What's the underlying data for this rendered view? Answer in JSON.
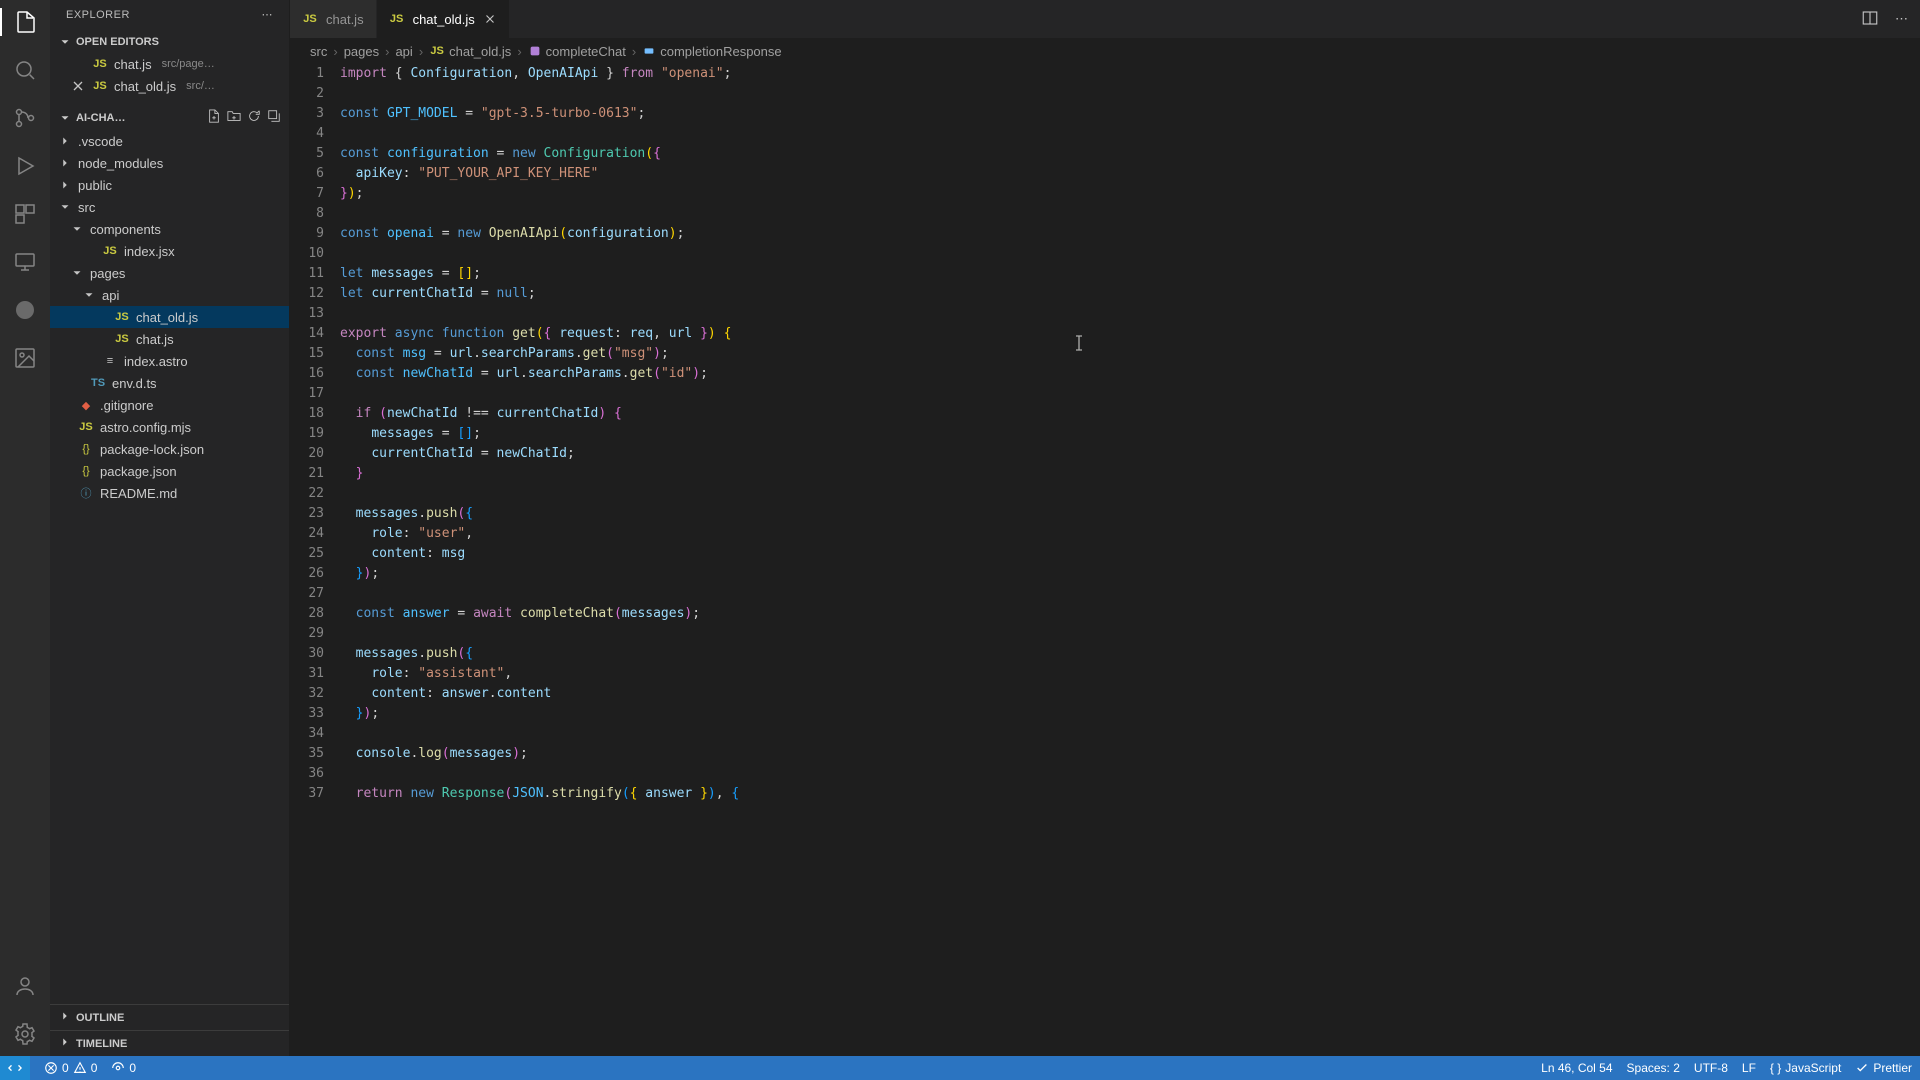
{
  "sidebar": {
    "title": "EXPLORER",
    "openEditors": {
      "title": "OPEN EDITORS",
      "items": [
        {
          "name": "chat.js",
          "path": "src/page…",
          "iconCls": "js",
          "iconText": "JS",
          "dirty": false
        },
        {
          "name": "chat_old.js",
          "path": "src/…",
          "iconCls": "js",
          "iconText": "JS",
          "dirty": false,
          "active": true
        }
      ]
    },
    "project": {
      "title": "AI-CHA…",
      "tree": [
        {
          "name": ".vscode",
          "type": "folder",
          "depth": 0,
          "open": false
        },
        {
          "name": "node_modules",
          "type": "folder",
          "depth": 0,
          "open": false
        },
        {
          "name": "public",
          "type": "folder",
          "depth": 0,
          "open": false
        },
        {
          "name": "src",
          "type": "folder",
          "depth": 0,
          "open": true
        },
        {
          "name": "components",
          "type": "folder",
          "depth": 1,
          "open": true
        },
        {
          "name": "index.jsx",
          "type": "file",
          "depth": 2,
          "iconCls": "js",
          "iconText": "JS"
        },
        {
          "name": "pages",
          "type": "folder",
          "depth": 1,
          "open": true
        },
        {
          "name": "api",
          "type": "folder",
          "depth": 2,
          "open": true
        },
        {
          "name": "chat_old.js",
          "type": "file",
          "depth": 3,
          "iconCls": "js",
          "iconText": "JS",
          "selected": true
        },
        {
          "name": "chat.js",
          "type": "file",
          "depth": 3,
          "iconCls": "js",
          "iconText": "JS"
        },
        {
          "name": "index.astro",
          "type": "file",
          "depth": 2,
          "iconCls": "astro",
          "iconText": "≡"
        },
        {
          "name": "env.d.ts",
          "type": "file",
          "depth": 1,
          "iconCls": "ts",
          "iconText": "TS"
        },
        {
          "name": ".gitignore",
          "type": "file",
          "depth": 0,
          "iconCls": "git",
          "iconText": "◆"
        },
        {
          "name": "astro.config.mjs",
          "type": "file",
          "depth": 0,
          "iconCls": "js",
          "iconText": "JS"
        },
        {
          "name": "package-lock.json",
          "type": "file",
          "depth": 0,
          "iconCls": "json",
          "iconText": "{}"
        },
        {
          "name": "package.json",
          "type": "file",
          "depth": 0,
          "iconCls": "json",
          "iconText": "{}"
        },
        {
          "name": "README.md",
          "type": "file",
          "depth": 0,
          "iconCls": "md",
          "iconText": "ⓘ"
        }
      ]
    },
    "outline": "OUTLINE",
    "timeline": "TIMELINE"
  },
  "tabs": [
    {
      "label": "chat.js",
      "iconCls": "js",
      "iconText": "JS",
      "active": false
    },
    {
      "label": "chat_old.js",
      "iconCls": "js",
      "iconText": "JS",
      "active": true
    }
  ],
  "breadcrumbs": [
    {
      "label": "src"
    },
    {
      "label": "pages"
    },
    {
      "label": "api"
    },
    {
      "label": "chat_old.js",
      "icon": "js"
    },
    {
      "label": "completeChat",
      "icon": "method"
    },
    {
      "label": "completionResponse",
      "icon": "variable"
    }
  ],
  "code": [
    [
      [
        "kw",
        "import"
      ],
      [
        "punc",
        " { "
      ],
      [
        "var",
        "Configuration"
      ],
      [
        "punc",
        ", "
      ],
      [
        "var",
        "OpenAIApi"
      ],
      [
        "punc",
        " } "
      ],
      [
        "kw",
        "from"
      ],
      [
        "punc",
        " "
      ],
      [
        "str",
        "\"openai\""
      ],
      [
        "punc",
        ";"
      ]
    ],
    [],
    [
      [
        "kw2",
        "const"
      ],
      [
        "punc",
        " "
      ],
      [
        "const",
        "GPT_MODEL"
      ],
      [
        "punc",
        " = "
      ],
      [
        "str",
        "\"gpt-3.5-turbo-0613\""
      ],
      [
        "punc",
        ";"
      ]
    ],
    [],
    [
      [
        "kw2",
        "const"
      ],
      [
        "punc",
        " "
      ],
      [
        "const",
        "configuration"
      ],
      [
        "punc",
        " = "
      ],
      [
        "kw2",
        "new"
      ],
      [
        "punc",
        " "
      ],
      [
        "cls",
        "Configuration"
      ],
      [
        "brace",
        "("
      ],
      [
        "brace2",
        "{"
      ]
    ],
    [
      [
        "punc",
        "  "
      ],
      [
        "var",
        "apiKey"
      ],
      [
        "punc",
        ": "
      ],
      [
        "str",
        "\"PUT_YOUR_API_KEY_HERE\""
      ]
    ],
    [
      [
        "brace2",
        "}"
      ],
      [
        "brace",
        ")"
      ],
      [
        "punc",
        ";"
      ]
    ],
    [],
    [
      [
        "kw2",
        "const"
      ],
      [
        "punc",
        " "
      ],
      [
        "const",
        "openai"
      ],
      [
        "punc",
        " = "
      ],
      [
        "kw2",
        "new"
      ],
      [
        "punc",
        " "
      ],
      [
        "fn",
        "OpenAIApi"
      ],
      [
        "brace",
        "("
      ],
      [
        "var",
        "configuration"
      ],
      [
        "brace",
        ")"
      ],
      [
        "punc",
        ";"
      ]
    ],
    [],
    [
      [
        "kw2",
        "let"
      ],
      [
        "punc",
        " "
      ],
      [
        "var",
        "messages"
      ],
      [
        "punc",
        " = "
      ],
      [
        "brace",
        "["
      ],
      [
        "brace",
        "]"
      ],
      [
        "punc",
        ";"
      ]
    ],
    [
      [
        "kw2",
        "let"
      ],
      [
        "punc",
        " "
      ],
      [
        "var",
        "currentChatId"
      ],
      [
        "punc",
        " = "
      ],
      [
        "kw2",
        "null"
      ],
      [
        "punc",
        ";"
      ]
    ],
    [],
    [
      [
        "kw",
        "export"
      ],
      [
        "punc",
        " "
      ],
      [
        "kw2",
        "async"
      ],
      [
        "punc",
        " "
      ],
      [
        "kw2",
        "function"
      ],
      [
        "punc",
        " "
      ],
      [
        "fn",
        "get"
      ],
      [
        "brace",
        "("
      ],
      [
        "brace2",
        "{"
      ],
      [
        "punc",
        " "
      ],
      [
        "var",
        "request"
      ],
      [
        "punc",
        ": "
      ],
      [
        "var",
        "req"
      ],
      [
        "punc",
        ", "
      ],
      [
        "var",
        "url"
      ],
      [
        "punc",
        " "
      ],
      [
        "brace2",
        "}"
      ],
      [
        "brace",
        ")"
      ],
      [
        "punc",
        " "
      ],
      [
        "brace",
        "{"
      ]
    ],
    [
      [
        "punc",
        "  "
      ],
      [
        "kw2",
        "const"
      ],
      [
        "punc",
        " "
      ],
      [
        "const",
        "msg"
      ],
      [
        "punc",
        " = "
      ],
      [
        "var",
        "url"
      ],
      [
        "punc",
        "."
      ],
      [
        "var",
        "searchParams"
      ],
      [
        "punc",
        "."
      ],
      [
        "fn",
        "get"
      ],
      [
        "brace2",
        "("
      ],
      [
        "str",
        "\"msg\""
      ],
      [
        "brace2",
        ")"
      ],
      [
        "punc",
        ";"
      ]
    ],
    [
      [
        "punc",
        "  "
      ],
      [
        "kw2",
        "const"
      ],
      [
        "punc",
        " "
      ],
      [
        "const",
        "newChatId"
      ],
      [
        "punc",
        " = "
      ],
      [
        "var",
        "url"
      ],
      [
        "punc",
        "."
      ],
      [
        "var",
        "searchParams"
      ],
      [
        "punc",
        "."
      ],
      [
        "fn",
        "get"
      ],
      [
        "brace2",
        "("
      ],
      [
        "str",
        "\"id\""
      ],
      [
        "brace2",
        ")"
      ],
      [
        "punc",
        ";"
      ]
    ],
    [],
    [
      [
        "punc",
        "  "
      ],
      [
        "kw",
        "if"
      ],
      [
        "punc",
        " "
      ],
      [
        "brace2",
        "("
      ],
      [
        "var",
        "newChatId"
      ],
      [
        "punc",
        " !== "
      ],
      [
        "var",
        "currentChatId"
      ],
      [
        "brace2",
        ")"
      ],
      [
        "punc",
        " "
      ],
      [
        "brace2",
        "{"
      ]
    ],
    [
      [
        "punc",
        "    "
      ],
      [
        "var",
        "messages"
      ],
      [
        "punc",
        " = "
      ],
      [
        "brace3",
        "["
      ],
      [
        "brace3",
        "]"
      ],
      [
        "punc",
        ";"
      ]
    ],
    [
      [
        "punc",
        "    "
      ],
      [
        "var",
        "currentChatId"
      ],
      [
        "punc",
        " = "
      ],
      [
        "var",
        "newChatId"
      ],
      [
        "punc",
        ";"
      ]
    ],
    [
      [
        "punc",
        "  "
      ],
      [
        "brace2",
        "}"
      ]
    ],
    [],
    [
      [
        "punc",
        "  "
      ],
      [
        "var",
        "messages"
      ],
      [
        "punc",
        "."
      ],
      [
        "fn",
        "push"
      ],
      [
        "brace2",
        "("
      ],
      [
        "brace3",
        "{"
      ]
    ],
    [
      [
        "punc",
        "    "
      ],
      [
        "var",
        "role"
      ],
      [
        "punc",
        ": "
      ],
      [
        "str",
        "\"user\""
      ],
      [
        "punc",
        ","
      ]
    ],
    [
      [
        "punc",
        "    "
      ],
      [
        "var",
        "content"
      ],
      [
        "punc",
        ": "
      ],
      [
        "var",
        "msg"
      ]
    ],
    [
      [
        "punc",
        "  "
      ],
      [
        "brace3",
        "}"
      ],
      [
        "brace2",
        ")"
      ],
      [
        "punc",
        ";"
      ]
    ],
    [],
    [
      [
        "punc",
        "  "
      ],
      [
        "kw2",
        "const"
      ],
      [
        "punc",
        " "
      ],
      [
        "const",
        "answer"
      ],
      [
        "punc",
        " = "
      ],
      [
        "kw",
        "await"
      ],
      [
        "punc",
        " "
      ],
      [
        "fn",
        "completeChat"
      ],
      [
        "brace2",
        "("
      ],
      [
        "var",
        "messages"
      ],
      [
        "brace2",
        ")"
      ],
      [
        "punc",
        ";"
      ]
    ],
    [],
    [
      [
        "punc",
        "  "
      ],
      [
        "var",
        "messages"
      ],
      [
        "punc",
        "."
      ],
      [
        "fn",
        "push"
      ],
      [
        "brace2",
        "("
      ],
      [
        "brace3",
        "{"
      ]
    ],
    [
      [
        "punc",
        "    "
      ],
      [
        "var",
        "role"
      ],
      [
        "punc",
        ": "
      ],
      [
        "str",
        "\"assistant\""
      ],
      [
        "punc",
        ","
      ]
    ],
    [
      [
        "punc",
        "    "
      ],
      [
        "var",
        "content"
      ],
      [
        "punc",
        ": "
      ],
      [
        "var",
        "answer"
      ],
      [
        "punc",
        "."
      ],
      [
        "var",
        "content"
      ]
    ],
    [
      [
        "punc",
        "  "
      ],
      [
        "brace3",
        "}"
      ],
      [
        "brace2",
        ")"
      ],
      [
        "punc",
        ";"
      ]
    ],
    [],
    [
      [
        "punc",
        "  "
      ],
      [
        "var",
        "console"
      ],
      [
        "punc",
        "."
      ],
      [
        "fn",
        "log"
      ],
      [
        "brace2",
        "("
      ],
      [
        "var",
        "messages"
      ],
      [
        "brace2",
        ")"
      ],
      [
        "punc",
        ";"
      ]
    ],
    [],
    [
      [
        "punc",
        "  "
      ],
      [
        "kw",
        "return"
      ],
      [
        "punc",
        " "
      ],
      [
        "kw2",
        "new"
      ],
      [
        "punc",
        " "
      ],
      [
        "cls",
        "Response"
      ],
      [
        "brace2",
        "("
      ],
      [
        "const",
        "JSON"
      ],
      [
        "punc",
        "."
      ],
      [
        "fn",
        "stringify"
      ],
      [
        "brace3",
        "("
      ],
      [
        "brace",
        "{"
      ],
      [
        "punc",
        " "
      ],
      [
        "var",
        "answer"
      ],
      [
        "punc",
        " "
      ],
      [
        "brace",
        "}"
      ],
      [
        "brace3",
        ")"
      ],
      [
        "punc",
        ", "
      ],
      [
        "brace3",
        "{"
      ]
    ]
  ],
  "statusbar": {
    "errors": "0",
    "warnings": "0",
    "ports": "0",
    "lncol": "Ln 46, Col 54",
    "spaces": "Spaces: 2",
    "encoding": "UTF-8",
    "eol": "LF",
    "language": "JavaScript",
    "prettier": "Prettier"
  }
}
